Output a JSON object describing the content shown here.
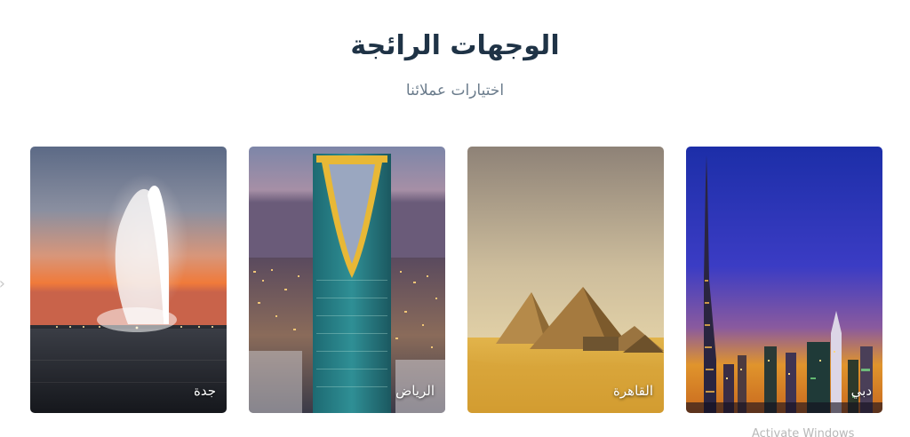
{
  "section": {
    "title": "الوجهات الرائجة",
    "subtitle": "اختيارات عملائنا"
  },
  "destinations": [
    {
      "name": "جدة",
      "icon": "fountain-image"
    },
    {
      "name": "الرياض",
      "icon": "kingdom-tower-image"
    },
    {
      "name": "القاهرة",
      "icon": "pyramids-image"
    },
    {
      "name": "دبي",
      "icon": "burj-khalifa-image"
    }
  ],
  "colors": {
    "title": "#1f3346",
    "subtitle": "#6b7c8c",
    "card_label": "#ffffff"
  },
  "overlay": {
    "watermark": "Activate Windows"
  }
}
